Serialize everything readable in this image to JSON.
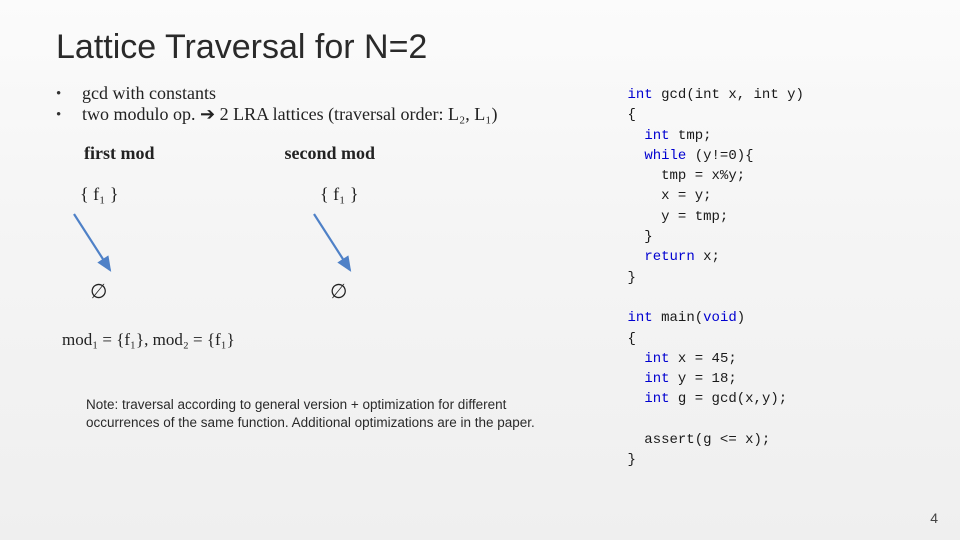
{
  "title": "Lattice Traversal for N=2",
  "bullets": [
    "gcd with constants",
    "two modulo op. ➔ 2 LRA lattices (traversal order: L₂, L₁)"
  ],
  "lattice_labels": {
    "first": "first mod",
    "second": "second mod"
  },
  "node_strings": {
    "top": "{ f₁ }",
    "bottom": "∅"
  },
  "assignment": "mod₁ = {f₁}, mod₂ = {f₁}",
  "note": "Note: traversal according to general version + optimization for different occurrences of the same function. Additional optimizations are in the paper.",
  "page_number": "4",
  "code": {
    "lines": [
      {
        "t": "int gcd(int x, int y)",
        "k": [
          "int",
          "int",
          "int"
        ]
      },
      {
        "t": "{"
      },
      {
        "t": "  int tmp;",
        "k": [
          "int"
        ]
      },
      {
        "t": "  while (y!=0){",
        "k": [
          "while"
        ]
      },
      {
        "t": "    tmp = x%y;"
      },
      {
        "t": "    x = y;"
      },
      {
        "t": "    y = tmp;"
      },
      {
        "t": "  }"
      },
      {
        "t": "  return x;",
        "k": [
          "return"
        ]
      },
      {
        "t": "}"
      },
      {
        "t": ""
      },
      {
        "t": "int main(void)",
        "k": [
          "int",
          "void"
        ]
      },
      {
        "t": "{"
      },
      {
        "t": "  int x = 45;",
        "k": [
          "int"
        ]
      },
      {
        "t": "  int y = 18;",
        "k": [
          "int"
        ]
      },
      {
        "t": "  int g = gcd(x,y);",
        "k": [
          "int"
        ]
      },
      {
        "t": ""
      },
      {
        "t": "  assert(g <= x);"
      },
      {
        "t": "}"
      }
    ]
  }
}
